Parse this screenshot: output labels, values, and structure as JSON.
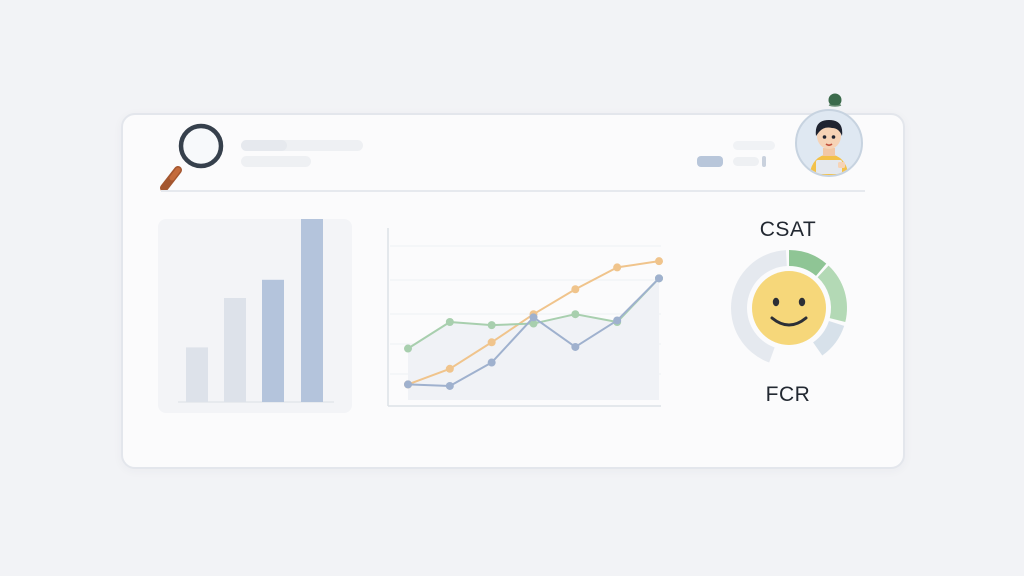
{
  "colors": {
    "background": "#f2f3f6",
    "card": "#fbfbfc",
    "bar_primary": "#b4c4dc",
    "bar_secondary": "#dde2ea",
    "series_orange": "#f0c48c",
    "series_green": "#a8cfae",
    "series_blue": "#9fb1ce",
    "gauge_green": "#a6d2a8",
    "gauge_gray": "#e0e5ec",
    "smiley": "#f6d77a"
  },
  "icons": {
    "search": "magnifier-icon",
    "avatar": "user-avatar-icon",
    "smiley": "smiley-face-icon"
  },
  "metrics": {
    "top_label": "CSAT",
    "bottom_label": "FCR"
  },
  "bar_chart": {
    "type": "bar",
    "values": [
      0.21,
      0.4,
      0.47,
      0.71
    ]
  },
  "chart_data": {
    "type": "line",
    "x": [
      1,
      2,
      3,
      4,
      5,
      6,
      7
    ],
    "series": [
      {
        "color": "#f0c48c",
        "values": [
          1.0,
          2.0,
          3.7,
          5.5,
          7.1,
          8.5,
          8.9
        ]
      },
      {
        "color": "#a8cfae",
        "values": [
          3.3,
          5.0,
          4.8,
          4.9,
          5.5,
          5.0,
          7.8
        ]
      },
      {
        "color": "#9fb1ce",
        "values": [
          1.0,
          0.9,
          2.4,
          5.3,
          3.4,
          5.1,
          7.8
        ]
      }
    ]
  },
  "gauge": {
    "level": 0.33
  }
}
